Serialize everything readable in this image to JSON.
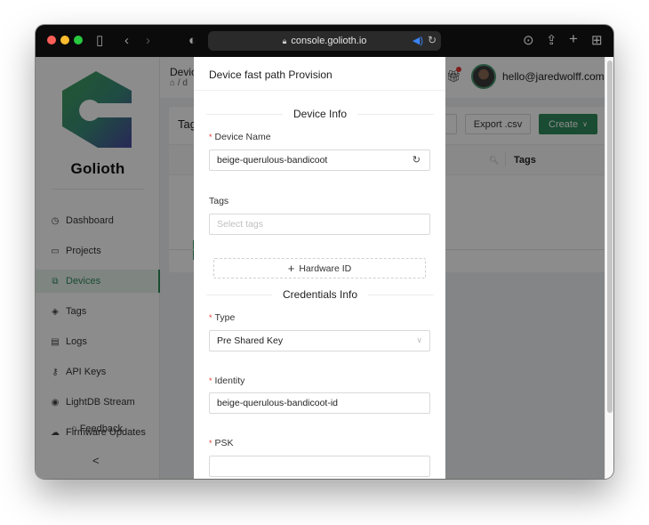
{
  "browser": {
    "url": "console.golioth.io",
    "colors": {
      "close": "#ff5f57",
      "minimize": "#febc2e",
      "zoom": "#28c840"
    }
  },
  "sidebar": {
    "brand": "Golioth",
    "items": [
      {
        "label": "Dashboard",
        "icon": "dashboard-icon",
        "glyph": "◷"
      },
      {
        "label": "Projects",
        "icon": "folder-icon",
        "glyph": "▭"
      },
      {
        "label": "Devices",
        "icon": "devices-icon",
        "glyph": "⧉",
        "active": true
      },
      {
        "label": "Tags",
        "icon": "tag-icon",
        "glyph": "◈"
      },
      {
        "label": "Logs",
        "icon": "logs-icon",
        "glyph": "▤"
      },
      {
        "label": "API Keys",
        "icon": "key-icon",
        "glyph": "⚷"
      },
      {
        "label": "LightDB Stream",
        "icon": "stream-icon",
        "glyph": "◉"
      },
      {
        "label": "Firmware Updates",
        "icon": "cloud-upload-icon",
        "glyph": "☁"
      }
    ],
    "feedback": "Feedback",
    "collapse_glyph": "<"
  },
  "header": {
    "title": "Devic",
    "breadcrumb_sep": "/",
    "breadcrumb_partial": "d",
    "user_email": "hello@jaredwolff.com"
  },
  "card": {
    "title": "Tag",
    "export_label": "Export .csv",
    "create_label": "Create",
    "col_tags": "Tags"
  },
  "drawer": {
    "title": "Device fast path Provision",
    "device_info_heading": "Device Info",
    "device_name_label": "Device Name",
    "device_name_value": "beige-querulous-bandicoot",
    "tags_label": "Tags",
    "tags_placeholder": "Select tags",
    "hardware_id_label": "Hardware ID",
    "credentials_heading": "Credentials Info",
    "type_label": "Type",
    "type_value": "Pre Shared Key",
    "identity_label": "Identity",
    "identity_value": "beige-querulous-bandicoot-id",
    "psk_label": "PSK",
    "psk_value": ""
  },
  "colors": {
    "brand_green": "#2f8a5c",
    "required": "#e53935"
  }
}
